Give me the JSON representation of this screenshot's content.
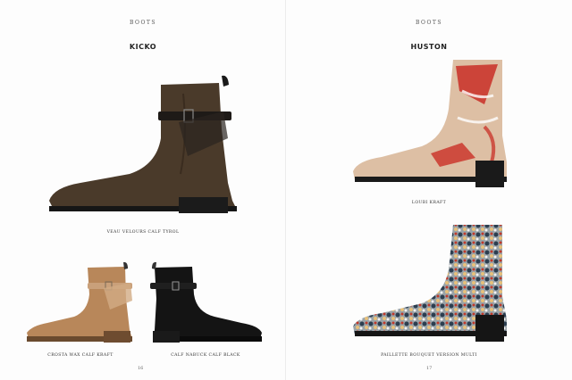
{
  "left_page": {
    "section": "BOOTS",
    "model": "KICKO",
    "main_caption": "VEAU VELOURS CALF TYROL",
    "small_captions": [
      "CROSTA WAX CALF KRAFT",
      "CALF NABUCK CALF BLACK"
    ],
    "page_number": "16"
  },
  "right_page": {
    "section": "BOOTS",
    "model": "HUSTON",
    "top_caption": "LOUBI KRAFT",
    "bottom_caption": "PAILLETTE BOUQUET VERSION MULTI",
    "page_number": "17"
  },
  "colors": {
    "suede_brown": "#4a3a2a",
    "tan": "#b8875a",
    "black": "#111111",
    "pvc_beige": "#d9b89a",
    "red_accent": "#c8261e"
  }
}
